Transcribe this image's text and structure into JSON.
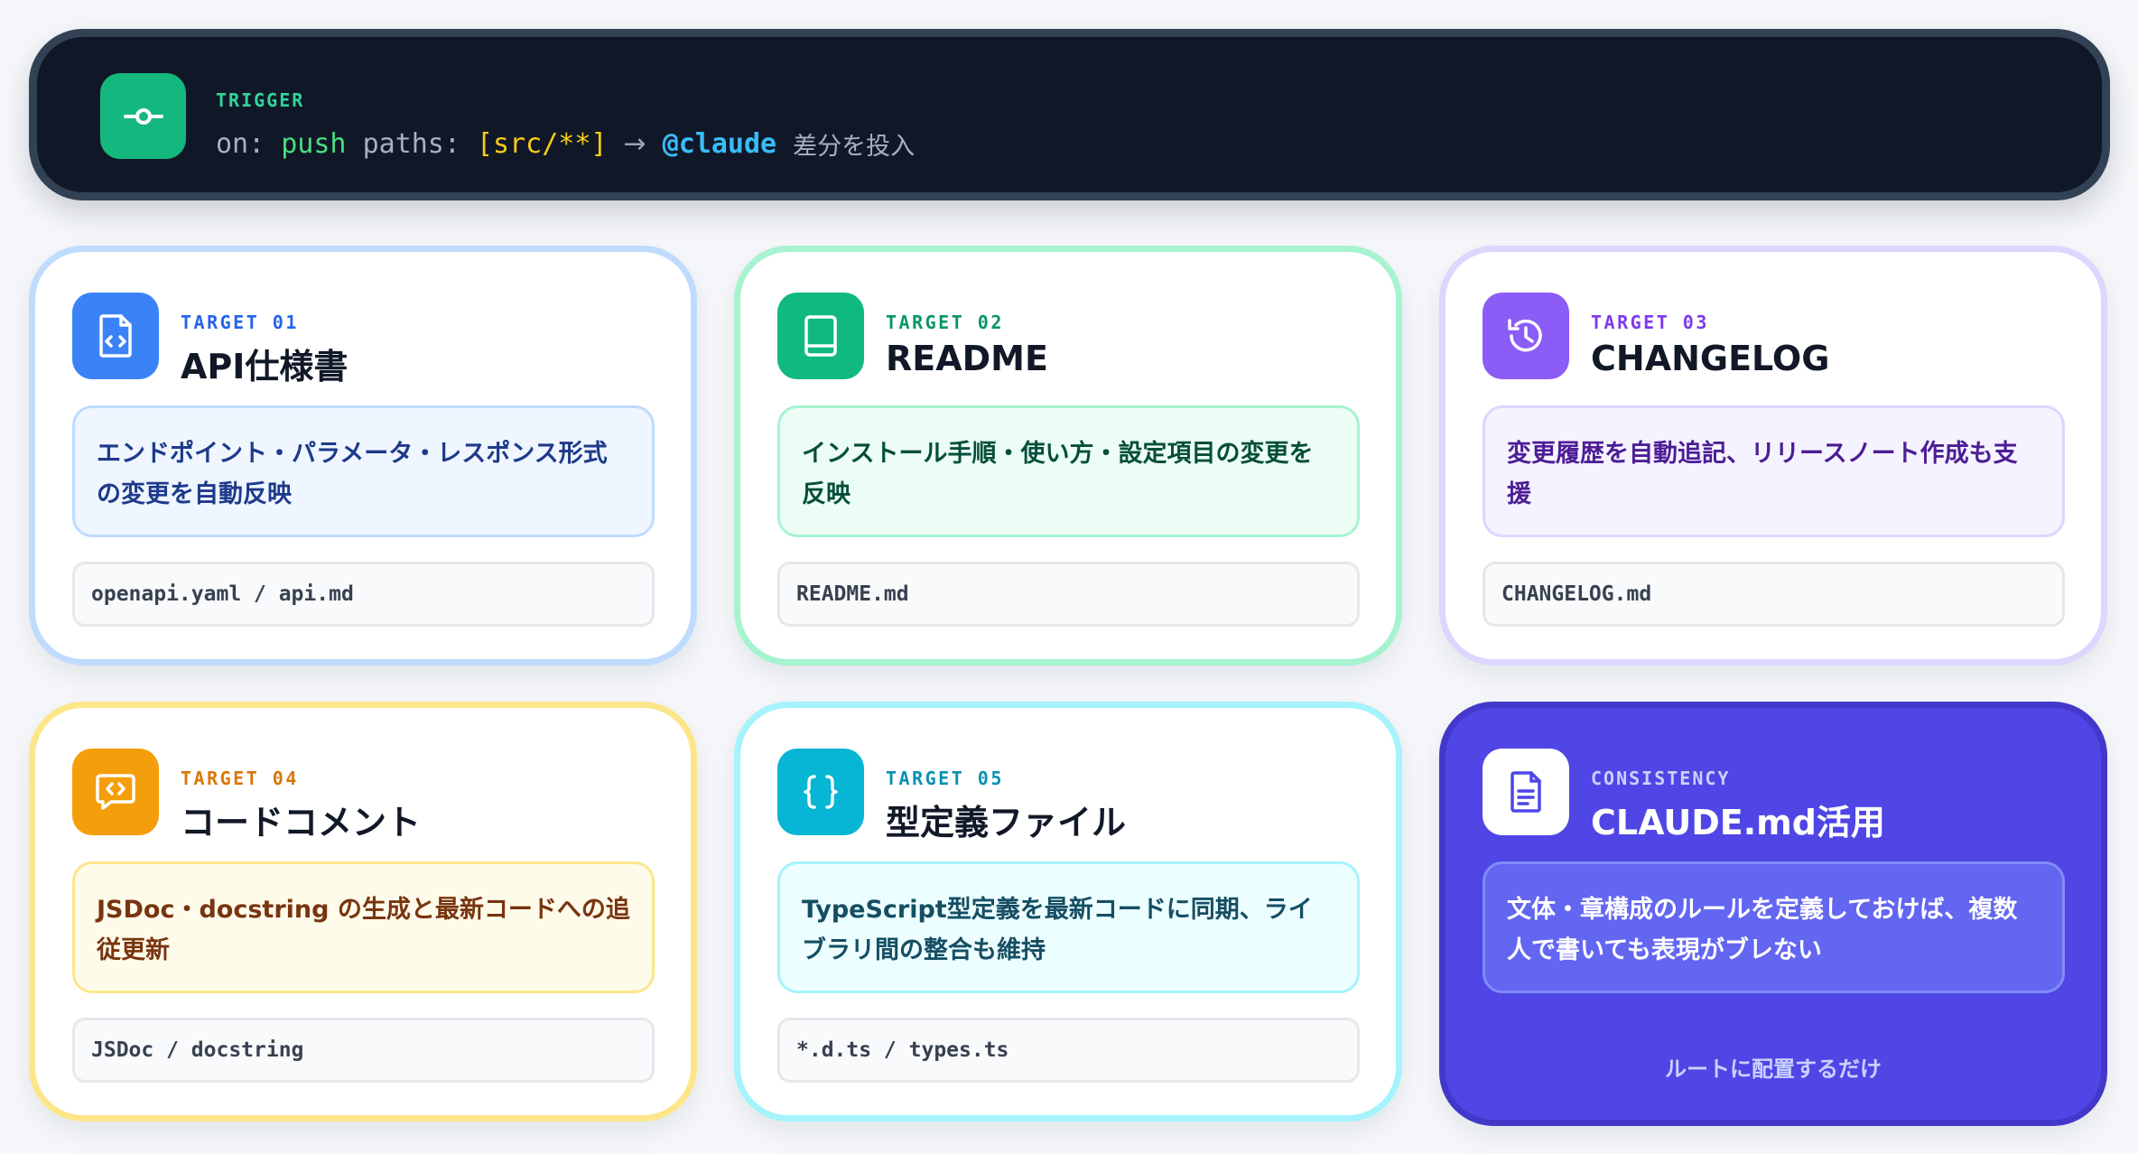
{
  "trigger": {
    "label": "TRIGGER",
    "kw_on": "on:",
    "kw_push": "push",
    "kw_paths": "paths:",
    "paths_value": "[src/**]",
    "arrow": "→",
    "mention": "@claude",
    "action": "差分を投入",
    "icon": "commit-icon"
  },
  "cards": [
    {
      "tag": "TARGET 01",
      "title": "API仕様書",
      "description": "エンドポイント・パラメータ・レスポンス形式の変更を自動反映",
      "path": "openapi.yaml / api.md",
      "icon": "file-code-icon",
      "colors": {
        "accent": "#3b82f6",
        "tag": "#2563eb",
        "desc_bg": "#eff6ff",
        "desc_border": "#bfdbfe",
        "desc_text": "#1e3a8a"
      }
    },
    {
      "tag": "TARGET 02",
      "title": "README",
      "description": "インストール手順・使い方・設定項目の変更を反映",
      "path": "README.md",
      "icon": "book-icon",
      "colors": {
        "accent": "#10b981",
        "tag": "#059669",
        "desc_bg": "#ecfdf5",
        "desc_border": "#a7f3d0",
        "desc_text": "#064e3b"
      }
    },
    {
      "tag": "TARGET 03",
      "title": "CHANGELOG",
      "description": "変更履歴を自動追記、リリースノート作成も支援",
      "path": "CHANGELOG.md",
      "icon": "history-icon",
      "colors": {
        "accent": "#8b5cf6",
        "tag": "#7c3aed",
        "desc_bg": "#f5f3ff",
        "desc_border": "#ddd6fe",
        "desc_text": "#4c1d95"
      }
    },
    {
      "tag": "TARGET 04",
      "title": "コードコメント",
      "description": "JSDoc・docstring の生成と最新コードへの追従更新",
      "path": "JSDoc / docstring",
      "icon": "comment-code-icon",
      "colors": {
        "accent": "#f59e0b",
        "tag": "#d97706",
        "desc_bg": "#fffbeb",
        "desc_border": "#fde68a",
        "desc_text": "#78350f"
      }
    },
    {
      "tag": "TARGET 05",
      "title": "型定義ファイル",
      "description": "TypeScript型定義を最新コードに同期、ライブラリ間の整合も維持",
      "path": "*.d.ts / types.ts",
      "icon": "braces-icon",
      "colors": {
        "accent": "#06b6d4",
        "tag": "#0891b2",
        "desc_bg": "#ecfeff",
        "desc_border": "#a5f3fc",
        "desc_text": "#164e63"
      }
    }
  ],
  "consistency": {
    "tag": "CONSISTENCY",
    "title": "CLAUDE.md活用",
    "description": "文体・章構成のルールを定義しておけば、複数人で書いても表現がブレない",
    "footnote": "ルートに配置するだけ",
    "icon": "document-icon",
    "colors": {
      "bg": "#4f46e5",
      "desc_bg": "#6366f1",
      "desc_border": "#818cf8"
    }
  }
}
